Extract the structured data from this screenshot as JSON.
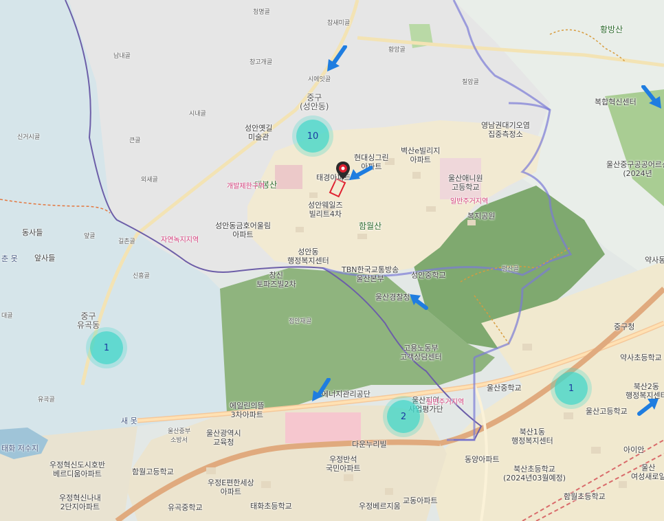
{
  "colors": {
    "accent_arrow": "#1f7de0",
    "cluster": "#40d6c8",
    "boundary": "#7b7bd6",
    "park": "#8cc47a",
    "forest": "#a7c99f",
    "urban": "#f3ecd6",
    "zone_label": "#d23a78"
  },
  "clusters": [
    {
      "count": "10"
    },
    {
      "count": "1"
    },
    {
      "count": "2"
    },
    {
      "count": "1"
    }
  ],
  "labels": {
    "cheonmyeonggol": "청명골",
    "chamsaemigol": "참새미골",
    "hwangangol": "황앙골",
    "namnaegol": "남내골",
    "changgogaegol": "창고개골",
    "sieoeusgol": "시에잇골",
    "sinaegol": "시내골",
    "keungol": "큰골",
    "singeosaegol": "신거시골",
    "oesaegol": "외새골",
    "dongsadeul": "동사들",
    "apsadeul": "앞사들",
    "apgol": "앞골",
    "gilchongol": "길촌골",
    "sinheunggol": "신흥골",
    "jeonganjaegol": "점안재골",
    "daegol": "대골",
    "yugokgol": "유곡골",
    "chilamgol": "칠암골",
    "hwangbangsan": "황방산",
    "junggu_seongandong": "중구\n(성안동)",
    "junggu_yugokdong": "중구\n유곡동",
    "seongan_ellgil_museum": "성안옛길\n미술관",
    "dachaesan": "대봉산",
    "devzone": "개발제한구역",
    "natural_green": "자연녹지지역",
    "taegyeong_apt": "태경아파트",
    "hyundae_apt": "현대싱그린\n아파트",
    "byeoksan_villa": "벽산e빌리지\n아파트",
    "seongan_wells": "성안웨일즈\n빌리트4차",
    "hamwolsan": "함월산",
    "seongandong_apt": "성안동금호어울림\n아파트",
    "seongan_center": "성안동\n행정복지센터",
    "changsin_topaz": "창신\n토파즈빌2차",
    "tbn": "TBN한국교통방송\n울산본부",
    "seongan_middle": "성안중학교",
    "ulsan_police": "울산경찰청",
    "yeongnam_office": "영남권대기오염\n집중측정소",
    "ulsan_aenien": "울산애니원\n고등학교",
    "residential_zone": "일반주거지역",
    "bokji_park": "복지공원",
    "pyeongsangol": "평산골",
    "bokhap_center": "복합혁신센터",
    "ulsan_junggu_park": "울산중구공공어르신\n(2024년",
    "yaksadong": "약사동",
    "junggucheong": "중구청",
    "yaksa_elementary": "약사초등학교",
    "ulsan_middle": "울산중학교",
    "ulsan_high": "울산고등학교",
    "bukan2": "북산2동\n행정복지센터",
    "bukan1": "북산1동\n행정복지센터",
    "bukan_elementary": "북산초등학교\n(2024년03월예정)",
    "hamwol_elementary": "함월초등학교",
    "dongyang_apt": "동양아파트",
    "ainan": "아이안",
    "ulsan_women": "울산\n여성새로일",
    "employ_center": "고용노동부\n고객상담센터",
    "energy_corp": "에너지관리공단",
    "ulsan_region": "울산지역\n사업평가단",
    "residential2": "일반주거지역",
    "emillin": "에일린의뜰\n3차아파트",
    "ulsan_police_hall": "울산광역시\n교육청",
    "ulsan_fire": "울산중부\n소방서",
    "danoonurivil": "다운누리빌",
    "ubangbaekseok": "우정반석\n국민아파트",
    "ujeong_apt": "우정E편한세상\n아파트",
    "taehwa_elementary": "태화초등학교",
    "gyodong_apt": "교동아파트",
    "ubang_better": "우정베르지움",
    "hyeoksin_city": "우정혁신도시호반\n베르디움아파트",
    "ujeong_2danji": "우정혁신나내\n2단지아파트",
    "hamwol_high": "함월고등학교",
    "yugok_middle": "유곡중학교",
    "taehwa_reservoir": "태화 저수지",
    "saedong": "새 못",
    "cheongot": "춘 못",
    "chilam": "칠암골",
    "apartment_small": "아파트",
    "jeungsin": "중구청"
  },
  "icons": {
    "map_pin": "map-pin-icon",
    "arrow": "arrow-icon",
    "cluster": "cluster-marker"
  }
}
